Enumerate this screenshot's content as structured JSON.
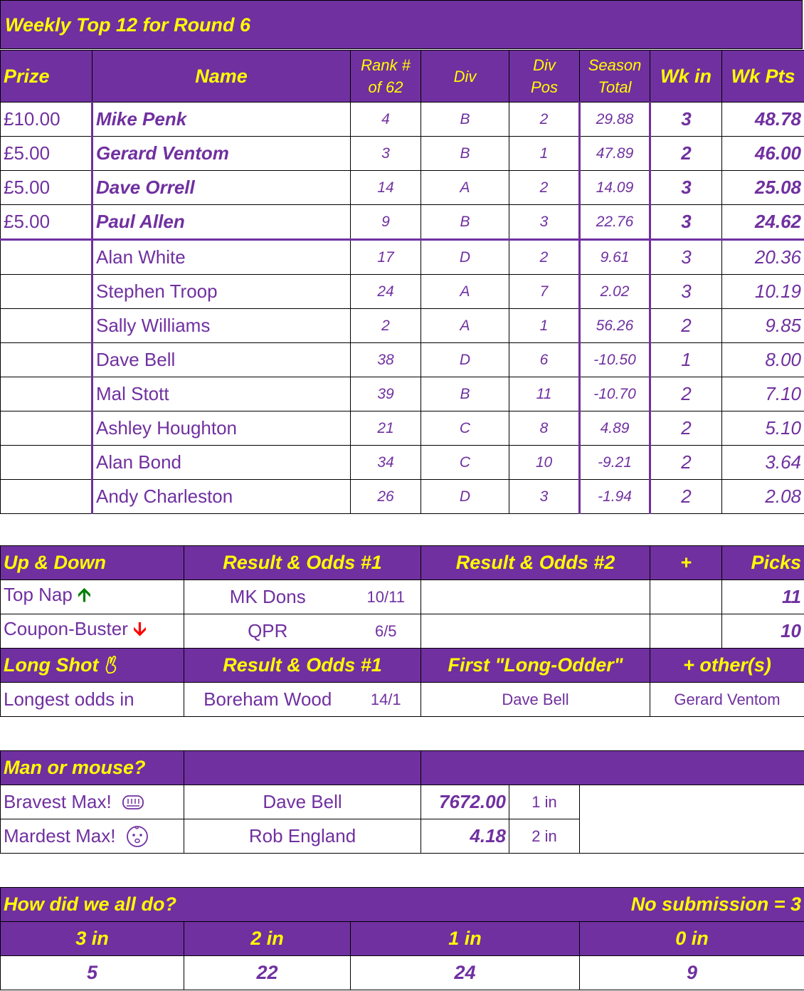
{
  "title": "Weekly Top 12 for Round 6",
  "top12": {
    "headers": {
      "prize": "Prize",
      "name": "Name",
      "rank_l1": "Rank #",
      "rank_l2": "of 62",
      "div": "Div",
      "divpos_l1": "Div",
      "divpos_l2": "Pos",
      "season_l1": "Season",
      "season_l2": "Total",
      "wkin": "Wk in",
      "wkpts": "Wk Pts"
    },
    "rows": [
      {
        "prize": "£10.00",
        "name": "Mike Penk",
        "rank": "4",
        "div": "B",
        "divpos": "2",
        "season": "29.88",
        "wkin": "3",
        "wkpts": "48.78"
      },
      {
        "prize": "£5.00",
        "name": "Gerard Ventom",
        "rank": "3",
        "div": "B",
        "divpos": "1",
        "season": "47.89",
        "wkin": "2",
        "wkpts": "46.00"
      },
      {
        "prize": "£5.00",
        "name": "Dave Orrell",
        "rank": "14",
        "div": "A",
        "divpos": "2",
        "season": "14.09",
        "wkin": "3",
        "wkpts": "25.08"
      },
      {
        "prize": "£5.00",
        "name": "Paul Allen",
        "rank": "9",
        "div": "B",
        "divpos": "3",
        "season": "22.76",
        "wkin": "3",
        "wkpts": "24.62"
      },
      {
        "prize": "",
        "name": "Alan White",
        "rank": "17",
        "div": "D",
        "divpos": "2",
        "season": "9.61",
        "wkin": "3",
        "wkpts": "20.36"
      },
      {
        "prize": "",
        "name": "Stephen Troop",
        "rank": "24",
        "div": "A",
        "divpos": "7",
        "season": "2.02",
        "wkin": "3",
        "wkpts": "10.19"
      },
      {
        "prize": "",
        "name": "Sally Williams",
        "rank": "2",
        "div": "A",
        "divpos": "1",
        "season": "56.26",
        "wkin": "2",
        "wkpts": "9.85"
      },
      {
        "prize": "",
        "name": "Dave Bell",
        "rank": "38",
        "div": "D",
        "divpos": "6",
        "season": "-10.50",
        "wkin": "1",
        "wkpts": "8.00"
      },
      {
        "prize": "",
        "name": "Mal Stott",
        "rank": "39",
        "div": "B",
        "divpos": "11",
        "season": "-10.70",
        "wkin": "2",
        "wkpts": "7.10"
      },
      {
        "prize": "",
        "name": "Ashley Houghton",
        "rank": "21",
        "div": "C",
        "divpos": "8",
        "season": "4.89",
        "wkin": "2",
        "wkpts": "5.10"
      },
      {
        "prize": "",
        "name": "Alan Bond",
        "rank": "34",
        "div": "C",
        "divpos": "10",
        "season": "-9.21",
        "wkin": "2",
        "wkpts": "3.64"
      },
      {
        "prize": "",
        "name": "Andy Charleston",
        "rank": "26",
        "div": "D",
        "divpos": "3",
        "season": "-1.94",
        "wkin": "2",
        "wkpts": "2.08"
      }
    ]
  },
  "updown": {
    "header": {
      "label": "Up & Down",
      "r1": "Result & Odds #1",
      "r2": "Result & Odds #2",
      "plus": "+",
      "picks": "Picks"
    },
    "rows": [
      {
        "label": "Top Nap",
        "icon": "arrow-up-icon",
        "team": "MK Dons",
        "odds": "10/11",
        "picks": "11"
      },
      {
        "label": "Coupon-Buster",
        "icon": "arrow-down-icon",
        "team": "QPR",
        "odds": "6/5",
        "picks": "10"
      }
    ],
    "longshot_header": {
      "label": "Long Shot",
      "icon": "crossed-fingers-icon",
      "r1": "Result & Odds #1",
      "first": "First \"Long-Odder\"",
      "others": "+ other(s)"
    },
    "longshot_row": {
      "label": "Longest odds in",
      "team": "Boreham Wood",
      "odds": "14/1",
      "first": "Dave Bell",
      "others": "Gerard Ventom"
    }
  },
  "manmouse": {
    "header": "Man or mouse?",
    "rows": [
      {
        "label": "Bravest Max!",
        "icon": "fist-icon",
        "name": "Dave Bell",
        "value": "7672.00",
        "in": "1 in"
      },
      {
        "label": "Mardest Max!",
        "icon": "baby-face-icon",
        "name": "Rob England",
        "value": "4.18",
        "in": "2 in"
      }
    ]
  },
  "summary": {
    "title": "How did we all do?",
    "note": "No submission = 3",
    "headers": [
      "3 in",
      "2 in",
      "1 in",
      "0 in"
    ],
    "values": [
      "5",
      "22",
      "24",
      "9"
    ]
  },
  "colors": {
    "header_bg": "#7030a0",
    "header_text": "#ffff00",
    "body_text": "#7030a0",
    "up_arrow": "#008000",
    "down_arrow": "#ff0000"
  }
}
